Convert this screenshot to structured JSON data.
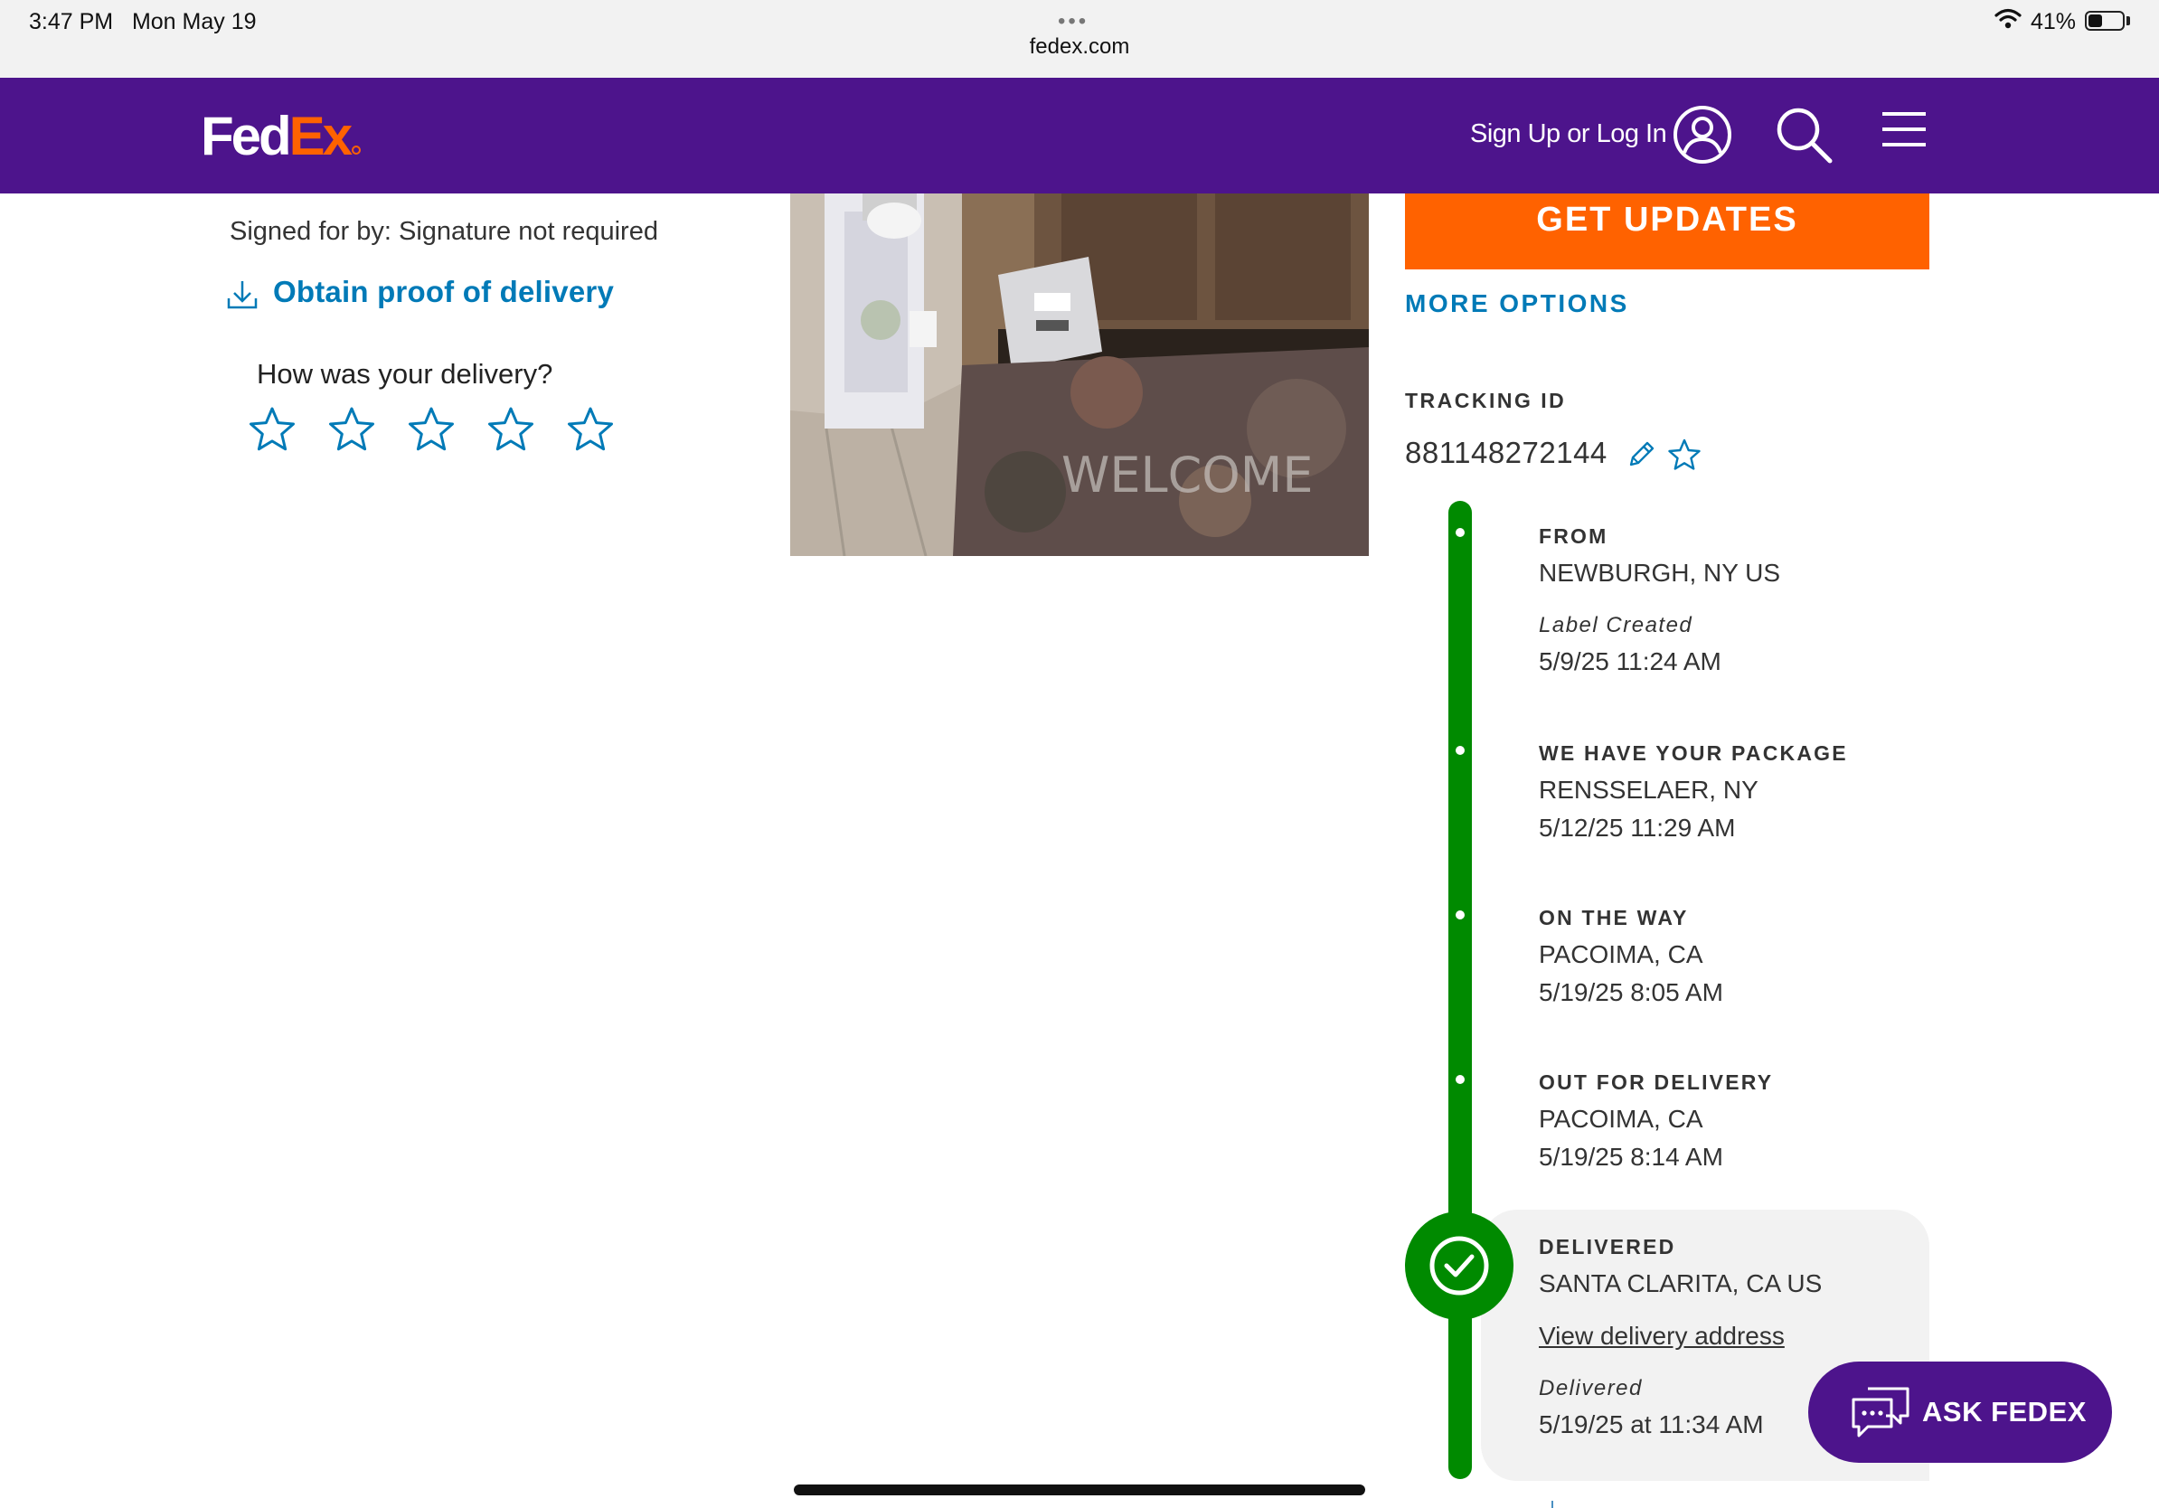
{
  "status_bar": {
    "time": "3:47 PM",
    "date": "Mon May 19",
    "url": "fedex.com",
    "battery": "41%",
    "battery_level": 0.41
  },
  "header": {
    "logo_fed": "Fed",
    "logo_ex": "Ex",
    "sign_in": "Sign Up or Log In",
    "icons": [
      "user-icon",
      "search-icon",
      "menu-icon"
    ]
  },
  "delivery": {
    "signed_for": "Signed for by: Signature not required",
    "proof_link": "Obtain proof of delivery",
    "rating_prompt": "How was your delivery?",
    "rating": 0,
    "rating_max": 5
  },
  "actions": {
    "get_updates": "GET UPDATES",
    "more_options": "MORE OPTIONS"
  },
  "tracking": {
    "label": "TRACKING ID",
    "id": "881148272144"
  },
  "events": [
    {
      "title": "FROM",
      "location": "NEWBURGH, NY US",
      "status": "Label Created",
      "time": "5/9/25 11:24 AM"
    },
    {
      "title": "WE HAVE YOUR PACKAGE",
      "location": "RENSSELAER, NY",
      "time": "5/12/25 11:29 AM"
    },
    {
      "title": "ON THE WAY",
      "location": "PACOIMA, CA",
      "time": "5/19/25 8:05 AM"
    },
    {
      "title": "OUT FOR DELIVERY",
      "location": "PACOIMA, CA",
      "time": "5/19/25 8:14 AM"
    },
    {
      "title": "DELIVERED",
      "location": "SANTA CLARITA, CA US",
      "link": "View delivery address",
      "status": "Delivered",
      "time": "5/19/25 at 11:34 AM"
    }
  ],
  "chat": {
    "label": "ASK FEDEX"
  },
  "colors": {
    "brand_purple": "#4d148c",
    "brand_orange": "#ff6200",
    "link_blue": "#007ab7",
    "progress_green": "#008a00"
  }
}
